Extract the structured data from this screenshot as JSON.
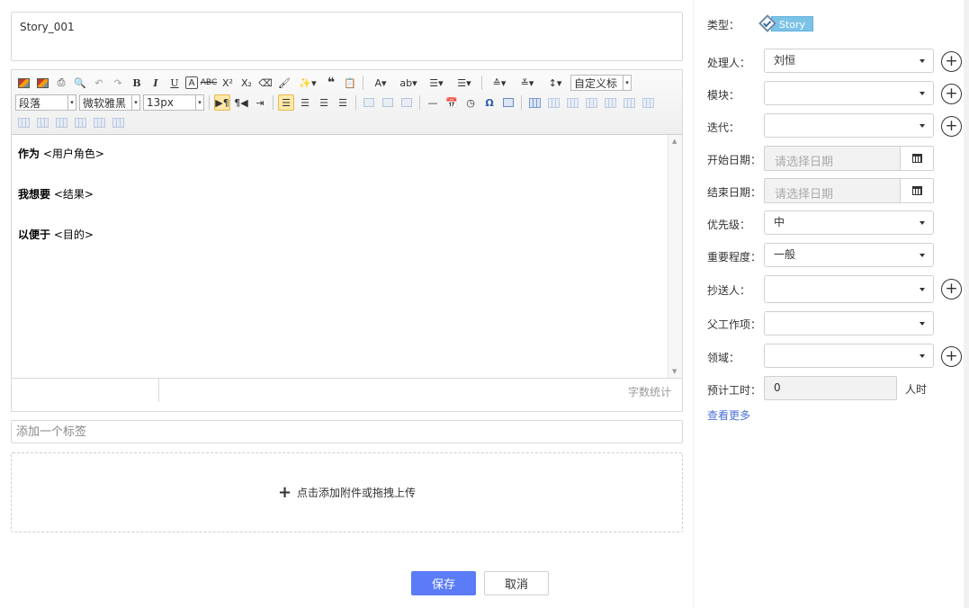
{
  "title_value": "Story_001",
  "editor": {
    "paragraph_select": "段落",
    "font_select": "微软雅黑",
    "size_select": "13px",
    "custom_title": "自定义标",
    "lines": [
      {
        "bold": "作为",
        "rest": " <用户角色>"
      },
      {
        "bold": "我想要",
        "rest": " <结果>"
      },
      {
        "bold": "以便于",
        "rest": " <目的>"
      }
    ],
    "word_count": "字数统计"
  },
  "tag_placeholder": "添加一个标签",
  "upload_text": "点击添加附件或拖拽上传",
  "buttons": {
    "save": "保存",
    "cancel": "取消"
  },
  "fields": {
    "type_label": "类型：",
    "type_value": "Story",
    "assignee_label": "处理人：",
    "assignee_value": "刘恒",
    "module_label": "模块：",
    "iteration_label": "迭代：",
    "start_label": "开始日期：",
    "start_placeholder": "请选择日期",
    "end_label": "结束日期：",
    "end_placeholder": "请选择日期",
    "priority_label": "优先级：",
    "priority_value": "中",
    "importance_label": "重要程度：",
    "importance_value": "一般",
    "cc_label": "抄送人：",
    "parent_label": "父工作项：",
    "domain_label": "领域：",
    "estimate_label": "预计工时：",
    "estimate_value": "0",
    "estimate_unit": "人时",
    "more_link": "查看更多"
  },
  "colors": {
    "primary": "#5b7cf6",
    "link": "#4a6fd8",
    "story_badge": "#7cc3e8"
  }
}
